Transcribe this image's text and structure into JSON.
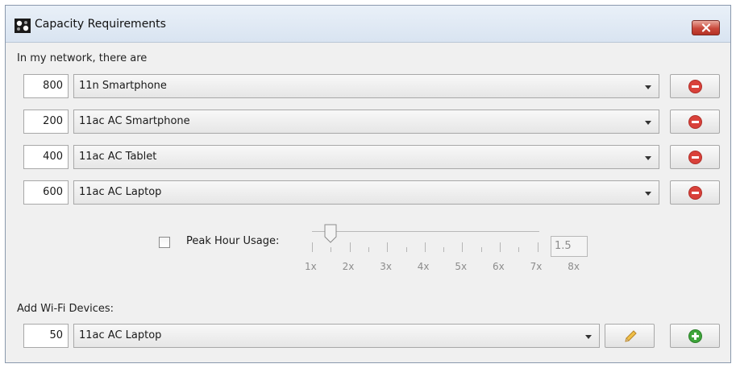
{
  "window": {
    "title": "Capacity Requirements"
  },
  "network": {
    "label": "In my network, there are",
    "rows": [
      {
        "count": "800",
        "device": "11n Smartphone"
      },
      {
        "count": "200",
        "device": "11ac AC Smartphone"
      },
      {
        "count": "400",
        "device": "11ac AC Tablet"
      },
      {
        "count": "600",
        "device": "11ac AC Laptop"
      }
    ]
  },
  "peak": {
    "label": "Peak Hour Usage:",
    "checked": false,
    "value": "1.5",
    "tick_labels": [
      "1x",
      "2x",
      "3x",
      "4x",
      "5x",
      "6x",
      "7x",
      "8x"
    ]
  },
  "add": {
    "label": "Add Wi-Fi Devices:",
    "count": "50",
    "device": "11ac AC Laptop"
  },
  "icons": {
    "remove": "remove-circle-icon",
    "edit": "pencil-icon",
    "add": "add-circle-icon",
    "close": "close-x-icon"
  },
  "colors": {
    "remove": "#d9413a",
    "add": "#3ea53a",
    "edit": "#e8b03a"
  }
}
